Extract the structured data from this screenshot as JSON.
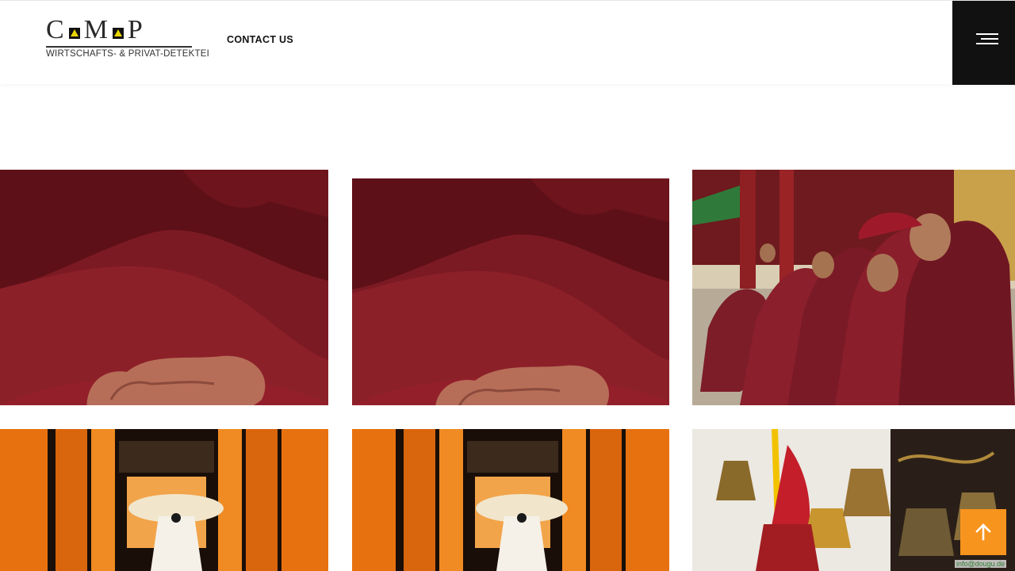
{
  "header": {
    "logo": {
      "letters": [
        "C",
        "M",
        "P"
      ],
      "subtitle": "WIRTSCHAFTS- & PRIVAT-DETEKTEI",
      "accent_color": "#e8d400"
    },
    "nav": {
      "contact_label": "CONTACT US"
    },
    "menu_icon": "hamburger-icon"
  },
  "gallery": {
    "tiles": [
      {
        "name": "monk-hands-photo-1",
        "subject": "monk-hands"
      },
      {
        "name": "monk-hands-photo-2",
        "subject": "monk-hands"
      },
      {
        "name": "monks-seated-photo",
        "subject": "monks-row"
      },
      {
        "name": "torii-gates-photo-1",
        "subject": "torii-gates"
      },
      {
        "name": "torii-gates-photo-2",
        "subject": "torii-gates"
      },
      {
        "name": "temple-bells-photo",
        "subject": "bells"
      }
    ]
  },
  "scroll_top": {
    "icon": "arrow-up-icon",
    "color": "#f7941d"
  },
  "footer": {
    "email": "info@dougu.de"
  }
}
